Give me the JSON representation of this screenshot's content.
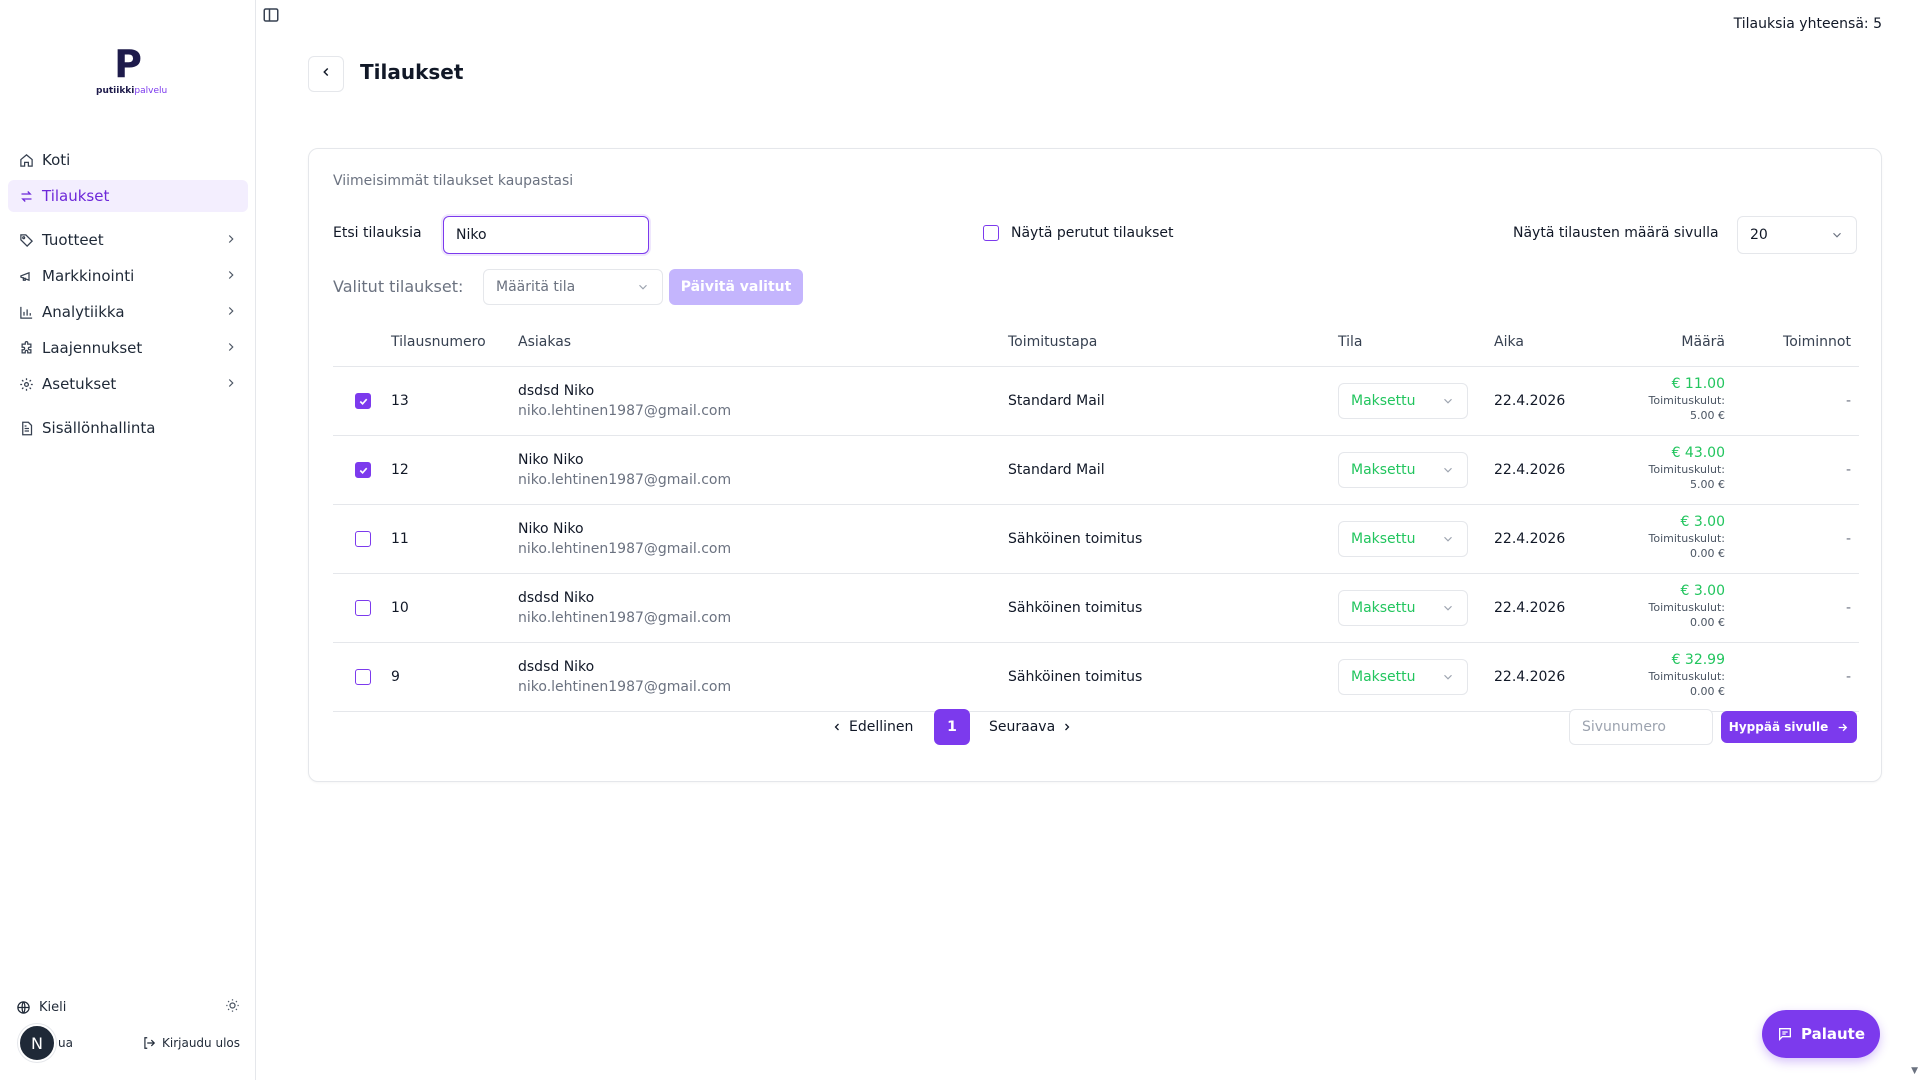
{
  "logo": {
    "mark": "P",
    "text_dark": "putiikki",
    "text_accent": "palvelu"
  },
  "sidebar": {
    "items": [
      {
        "label": "Koti",
        "icon": "home-icon",
        "active": false,
        "chevron": false
      },
      {
        "label": "Tilaukset",
        "icon": "arrows-swap-icon",
        "active": true,
        "chevron": false
      },
      {
        "label": "Tuotteet",
        "icon": "tag-icon",
        "active": false,
        "chevron": true
      },
      {
        "label": "Markkinointi",
        "icon": "megaphone-icon",
        "active": false,
        "chevron": true
      },
      {
        "label": "Analytiikka",
        "icon": "bar-chart-icon",
        "active": false,
        "chevron": true
      },
      {
        "label": "Laajennukset",
        "icon": "puzzle-icon",
        "active": false,
        "chevron": true
      },
      {
        "label": "Asetukset",
        "icon": "gear-icon",
        "active": false,
        "chevron": true
      },
      {
        "label": "Sisällönhallinta",
        "icon": "document-icon",
        "active": false,
        "chevron": false
      }
    ],
    "language_label": "Kieli",
    "avatar_initial": "N",
    "help_partial": "ua",
    "logout_label": "Kirjaudu ulos"
  },
  "topbar": {
    "total_count": "Tilauksia yhteensä: 5"
  },
  "header": {
    "title": "Tilaukset"
  },
  "card": {
    "subtitle": "Viimeisimmät tilaukset kaupastasi",
    "search_label": "Etsi tilauksia",
    "search_value": "Niko",
    "show_cancelled_label": "Näytä perutut tilaukset",
    "per_page_label": "Näytä tilausten määrä sivulla",
    "per_page_value": "20",
    "selected_label": "Valitut tilaukset:",
    "status_placeholder": "Määritä tila",
    "update_button": "Päivitä valitut"
  },
  "table": {
    "headers": {
      "number": "Tilausnumero",
      "customer": "Asiakas",
      "shipping": "Toimitustapa",
      "state": "Tila",
      "time": "Aika",
      "amount": "Määrä",
      "actions": "Toiminnot"
    },
    "rows": [
      {
        "checked": true,
        "number": "13",
        "name": "dsdsd Niko",
        "email": "niko.lehtinen1987@gmail.com",
        "shipping": "Standard Mail",
        "state": "Maksettu",
        "time": "22.4.2026",
        "amount": "€ 11.00",
        "ship_label": "Toimituskulut:",
        "ship_cost": "5.00 €",
        "action": "-"
      },
      {
        "checked": true,
        "number": "12",
        "name": "Niko Niko",
        "email": "niko.lehtinen1987@gmail.com",
        "shipping": "Standard Mail",
        "state": "Maksettu",
        "time": "22.4.2026",
        "amount": "€ 43.00",
        "ship_label": "Toimituskulut:",
        "ship_cost": "5.00 €",
        "action": "-"
      },
      {
        "checked": false,
        "number": "11",
        "name": "Niko Niko",
        "email": "niko.lehtinen1987@gmail.com",
        "shipping": "Sähköinen toimitus",
        "state": "Maksettu",
        "time": "22.4.2026",
        "amount": "€ 3.00",
        "ship_label": "Toimituskulut:",
        "ship_cost": "0.00 €",
        "action": "-"
      },
      {
        "checked": false,
        "number": "10",
        "name": "dsdsd Niko",
        "email": "niko.lehtinen1987@gmail.com",
        "shipping": "Sähköinen toimitus",
        "state": "Maksettu",
        "time": "22.4.2026",
        "amount": "€ 3.00",
        "ship_label": "Toimituskulut:",
        "ship_cost": "0.00 €",
        "action": "-"
      },
      {
        "checked": false,
        "number": "9",
        "name": "dsdsd Niko",
        "email": "niko.lehtinen1987@gmail.com",
        "shipping": "Sähköinen toimitus",
        "state": "Maksettu",
        "time": "22.4.2026",
        "amount": "€ 32.99",
        "ship_label": "Toimituskulut:",
        "ship_cost": "0.00 €",
        "action": "-"
      }
    ]
  },
  "pagination": {
    "prev_label": "Edellinen",
    "current_page": "1",
    "next_label": "Seuraava",
    "page_input_placeholder": "Sivunumero",
    "jump_label": "Hyppää sivulle"
  },
  "feedback_label": "Palaute",
  "colors": {
    "accent": "#7c3aed",
    "accent_light": "#c4b5fd",
    "paid": "#22c55e",
    "active_bg": "#f3eefe"
  }
}
